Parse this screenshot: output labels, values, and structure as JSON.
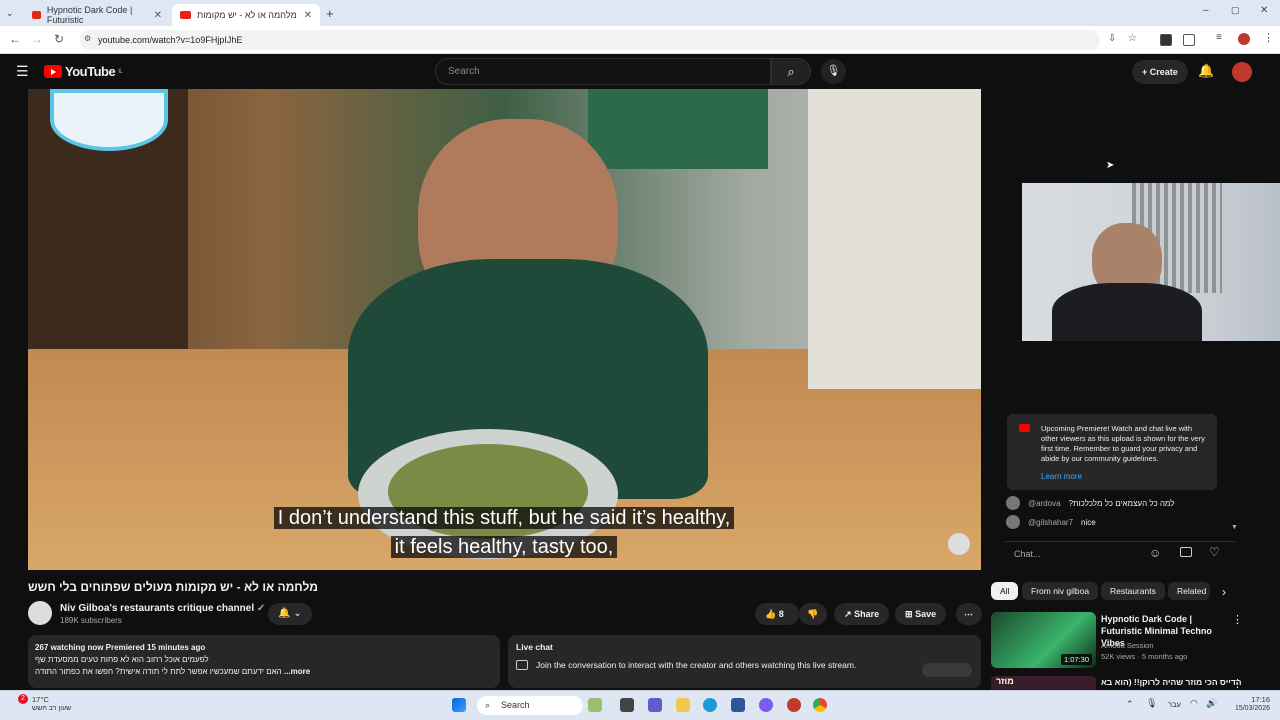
{
  "browser": {
    "tabs": [
      {
        "title": "Hypnotic Dark Code | Futuristic"
      },
      {
        "title": "מלחמה או לא - יש מקומות"
      }
    ],
    "url": "youtube.com/watch?v=1o9FHjpIJhE"
  },
  "header": {
    "logo_text": "YouTube",
    "region": "IL",
    "search_placeholder": "Search",
    "create_label": "Create"
  },
  "video": {
    "caption_line1": "I don’t understand this stuff, but he said it’s healthy,",
    "caption_line2": "it feels healthy, tasty too,",
    "title": "מלחמה או לא - יש מקומות מעולים שפתוחים בלי חשש"
  },
  "channel": {
    "name": "Niv Gilboa's restaurants critique channel",
    "subscribers": "189K subscribers"
  },
  "actions": {
    "likes": "8",
    "share": "Share",
    "save": "Save"
  },
  "description": {
    "stats": "267 watching now  Premiered 15 minutes ago",
    "line1": "לפעמים אוכל רחוב הוא לא פחות טעים ממסעדת שף",
    "line2": "האם ידעתם שמעכשיו אפשר לתת לי תודה אישית? חפשו את כפתור התודה",
    "more": "...more"
  },
  "livechat_box": {
    "title": "Live chat",
    "text": "Join the conversation to interact with the creator and others watching this live stream."
  },
  "chat": {
    "notice": "Upcoming Premiere! Watch and chat live with other viewers as this upload is shown for the very first time. Remember to guard your privacy and abide by our community guidelines.",
    "learn_more": "Learn more",
    "messages": [
      {
        "user": "@ardova",
        "text": "?למה כל העצמאים כל מלכלכות"
      },
      {
        "user": "@gilshahar7",
        "text": "nice"
      }
    ],
    "input_placeholder": "Chat..."
  },
  "chips": [
    "All",
    "From niv gilboa",
    "Restaurants",
    "Related"
  ],
  "recommendations": [
    {
      "title": "Hypnotic Dark Code | Futuristic Minimal Techno Vibes",
      "channel": "Amoda Session",
      "meta": "52K views · 5 months ago",
      "duration": "1:07:30"
    },
    {
      "thumb_text": "מוזר",
      "title": "הדייס הכי מוזר שהיה לרוקן!! (הוא בא"
    }
  ],
  "taskbar": {
    "weather_temp": "17°C",
    "weather_desc": "שעון רב חשש",
    "badge": "2",
    "search_label": "Search",
    "lang": "עבר",
    "time": "17:16",
    "date": "15/03/2026"
  },
  "colors": {
    "brand_red": "#ff0000",
    "link_blue": "#3ea6ff",
    "bg": "#0f0f0f"
  }
}
